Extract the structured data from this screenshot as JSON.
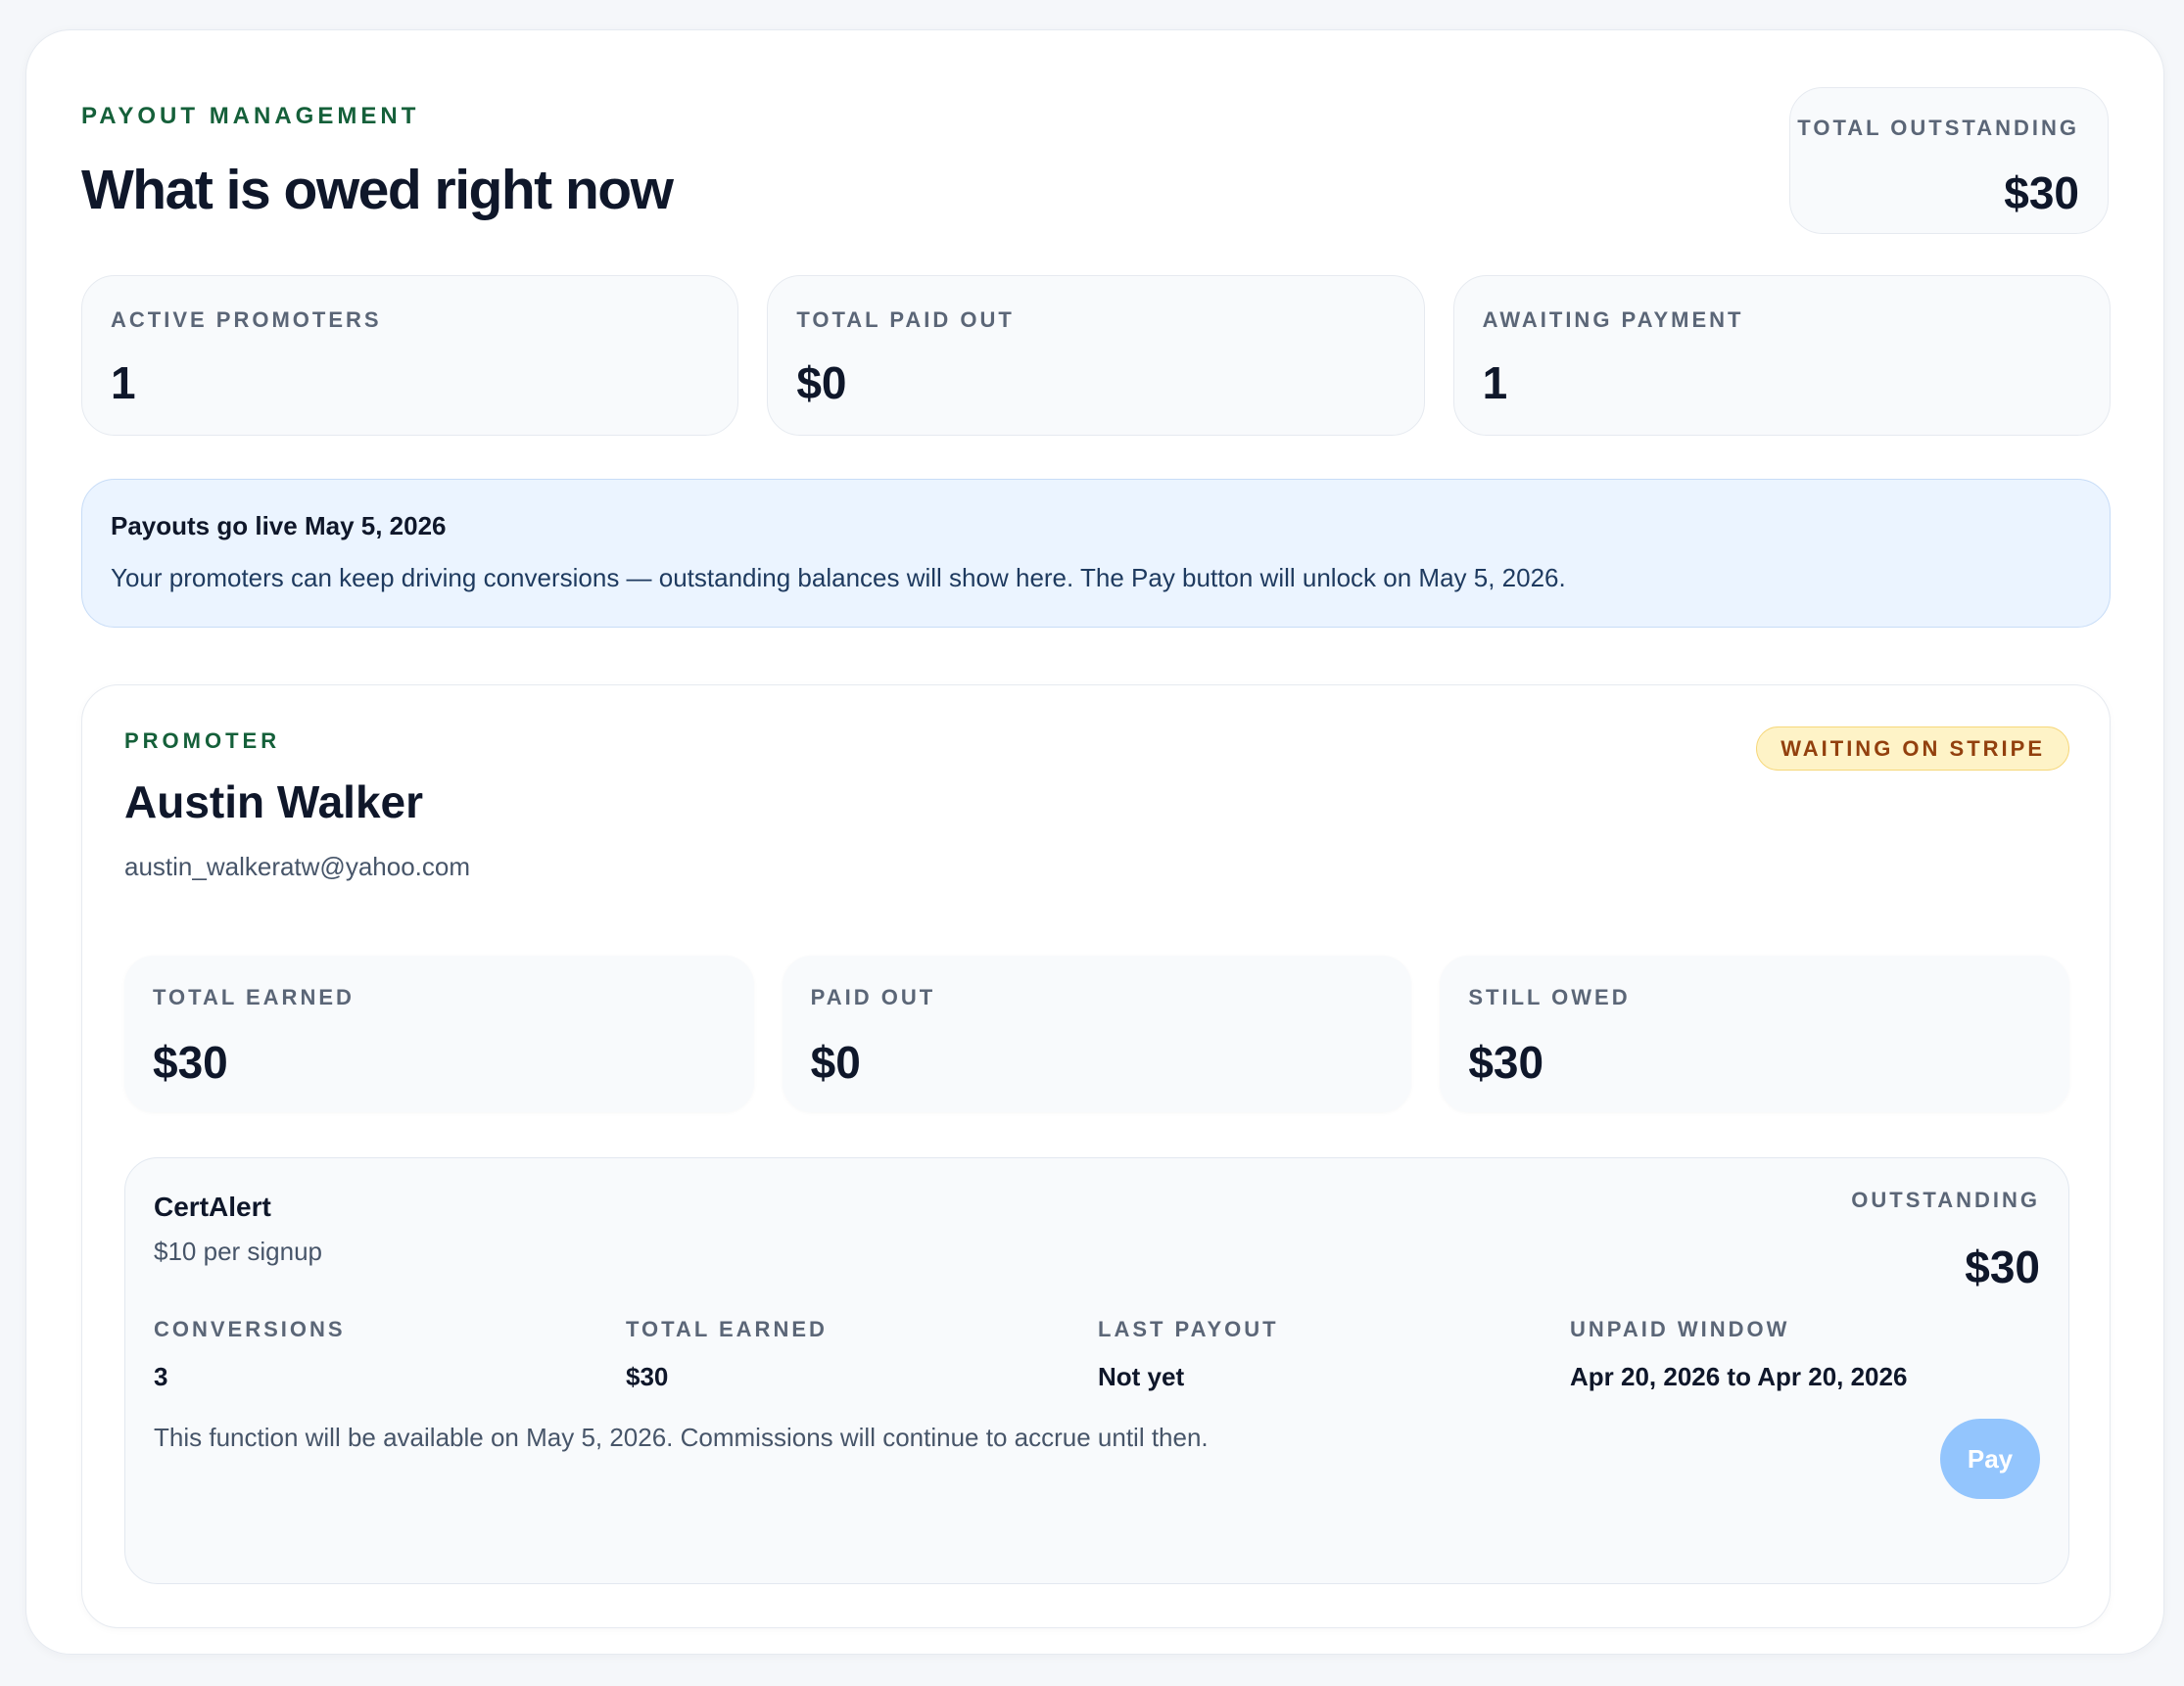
{
  "header": {
    "eyebrow": "PAYOUT MANAGEMENT",
    "title": "What is owed right now",
    "total_outstanding": {
      "label": "TOTAL OUTSTANDING",
      "value": "$30"
    }
  },
  "stats": [
    {
      "label": "ACTIVE PROMOTERS",
      "value": "1"
    },
    {
      "label": "TOTAL PAID OUT",
      "value": "$0"
    },
    {
      "label": "AWAITING PAYMENT",
      "value": "1"
    }
  ],
  "notice": {
    "title": "Payouts go live May 5, 2026",
    "body": "Your promoters can keep driving conversions — outstanding balances will show here. The Pay button will unlock on May 5, 2026."
  },
  "promoter": {
    "eyebrow": "PROMOTER",
    "name": "Austin Walker",
    "email": "austin_walkeratw@yahoo.com",
    "status": "WAITING ON STRIPE",
    "stats": [
      {
        "label": "TOTAL EARNED",
        "value": "$30"
      },
      {
        "label": "PAID OUT",
        "value": "$0"
      },
      {
        "label": "STILL OWED",
        "value": "$30"
      }
    ],
    "program": {
      "name": "CertAlert",
      "rate": "$10 per signup",
      "outstanding_label": "OUTSTANDING",
      "outstanding_value": "$30",
      "metrics": [
        {
          "label": "CONVERSIONS",
          "value": "3"
        },
        {
          "label": "TOTAL EARNED",
          "value": "$30"
        },
        {
          "label": "LAST PAYOUT",
          "value": "Not yet"
        },
        {
          "label": "UNPAID WINDOW",
          "value": "Apr 20, 2026 to Apr 20, 2026"
        }
      ],
      "note": "This function will be available on May 5, 2026. Commissions will continue to accrue until then.",
      "pay_label": "Pay"
    }
  },
  "colors": {
    "accent_green": "#15603a",
    "notice_bg": "#ebf4ff",
    "badge_bg": "#fef3c7",
    "badge_text": "#92400e",
    "pay_button_disabled": "#93c5fd"
  }
}
